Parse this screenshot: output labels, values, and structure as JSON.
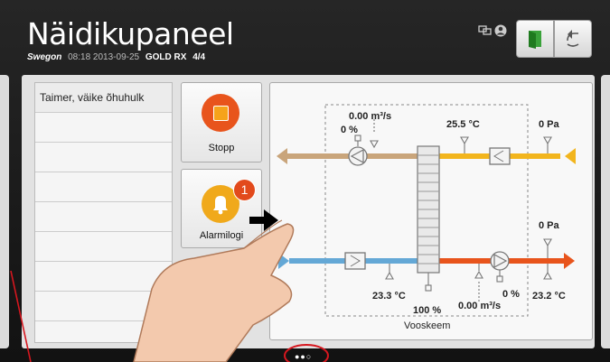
{
  "header": {
    "title": "Näidikupaneel",
    "brand": "Swegon",
    "datetime": "08:18 2013-09-25",
    "model": "GOLD RX",
    "page": "4/4"
  },
  "list": {
    "items": [
      "Taimer, väike õhuhulk",
      "",
      "",
      "",
      "",
      "",
      "",
      ""
    ]
  },
  "tiles": {
    "stop_label": "Stopp",
    "alarm_label": "Alarmilogi",
    "alarm_count": "1"
  },
  "schematic": {
    "extract_flow": "0.00 m³/s",
    "extract_fan_pct": "0 %",
    "extract_temp": "25.5 °C",
    "extract_pressure": "0 Pa",
    "supply_pressure": "0 Pa",
    "outdoor_temp": "23.3 °C",
    "exchanger_pct": "100 %",
    "supply_fan_pct": "0 %",
    "supply_flow": "0.00 m³/s",
    "supply_temp": "23.2 °C",
    "label": "Vooskeem"
  },
  "colors": {
    "extract_duct": "#c9a57b",
    "exhaust_duct": "#f2b51d",
    "outdoor_duct": "#64a8d6",
    "supply_duct": "#e8541c",
    "annotation": "#d6171f"
  },
  "icons": {
    "status": [
      "network-icon",
      "user-icon"
    ],
    "top_buttons": [
      "door-exit-icon",
      "back-arrow-icon"
    ],
    "page_dots": "●●○"
  }
}
